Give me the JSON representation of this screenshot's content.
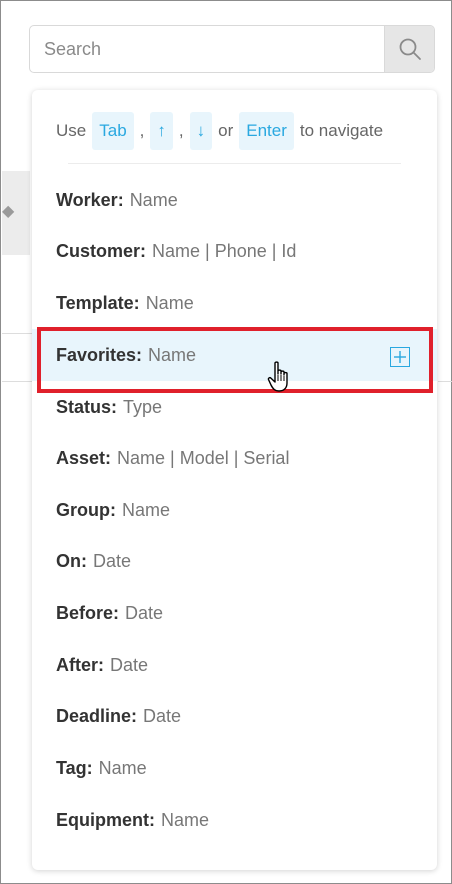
{
  "search": {
    "placeholder": "Search",
    "value": "",
    "button_icon": "search-icon"
  },
  "hint": {
    "prefix": "Use",
    "keys": [
      "Tab",
      "↑",
      "↓",
      "Enter"
    ],
    "separator": ",",
    "or": "or",
    "suffix": "to navigate"
  },
  "items": [
    {
      "key": "Worker:",
      "value": "Name"
    },
    {
      "key": "Customer:",
      "value": "Name | Phone | Id"
    },
    {
      "key": "Template:",
      "value": "Name"
    },
    {
      "key": "Favorites:",
      "value": "Name",
      "highlighted": true,
      "action_icon": "add-favorite-icon"
    },
    {
      "key": "Status:",
      "value": "Type"
    },
    {
      "key": "Asset:",
      "value": "Name | Model | Serial"
    },
    {
      "key": "Group:",
      "value": "Name"
    },
    {
      "key": "On:",
      "value": "Date"
    },
    {
      "key": "Before:",
      "value": "Date"
    },
    {
      "key": "After:",
      "value": "Date"
    },
    {
      "key": "Deadline:",
      "value": "Date"
    },
    {
      "key": "Tag:",
      "value": "Name"
    },
    {
      "key": "Equipment:",
      "value": "Name"
    }
  ],
  "colors": {
    "accent": "#29a8e0",
    "highlight_bg": "#e8f5fc",
    "highlight_outline": "#e0202b"
  }
}
